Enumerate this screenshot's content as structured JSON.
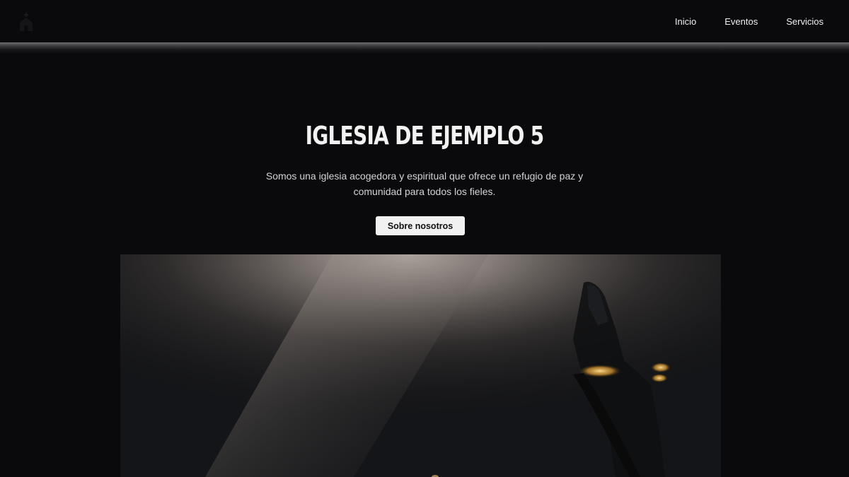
{
  "navbar": {
    "logo_icon": "church-icon",
    "links": [
      {
        "label": "Inicio"
      },
      {
        "label": "Eventos"
      },
      {
        "label": "Servicios"
      }
    ]
  },
  "hero": {
    "title": "IGLESIA DE EJEMPLO 5",
    "subtitle": "Somos una iglesia acogedora y espiritual que ofrece un refugio de paz y comunidad para todos los fieles.",
    "button_label": "Sobre nosotros",
    "image_icon": "worship-photo"
  },
  "colors": {
    "background": "#0a0a0c",
    "button_bg": "#f1f1f1",
    "text": "#f2f2f2"
  }
}
